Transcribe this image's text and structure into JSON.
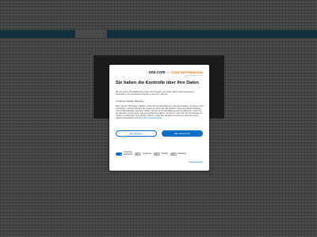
{
  "dialog": {
    "logo": {
      "brand": "one.com",
      "ampersand": "&",
      "partner": "CODE INFORMATION",
      "tagline": "code information consent"
    },
    "title": "Sie haben die Kontrolle über Ihre Daten",
    "intro": "Wir und unsere Geschäftspartner nutzen Technologien wie Cookies dazu, personenbezogene Informationen für verschiedene Zwecke zu sammeln, darunter:",
    "purposes": "Funktional, Statistik, Marketing",
    "body": "Wenn Sie auf \"Akzeptieren\" klicken, erteilen Sie Ihre Einwilligung für alle diese Zwecke. Sie können auch entscheiden, welchen Zwecken Sie zustimmen, indem Sie das Kästchen neben dem Zweck anklicken und auf \"Einstellungen speichern\" klicken. Sie können Ihre Einwilligung jederzeit widerrufen, indem Sie auf das kleine Symbol unten links auf der Webseite klicken. Sie können mehr über die Verwendung von Cookies und ähnlichen Technologien erfahren, sowie über die Datenverarbeitung, lesen Sie unsere Datenschutzrichtlinien und",
    "body_link": "Mehr über Cookie-Richtlinie",
    "reject_label": "Alle ablehnen",
    "accept_label": "Alle akzeptieren",
    "toggles": [
      {
        "label_line1": "Unbedingt",
        "label_line2": "erforderlich",
        "on": true
      },
      {
        "label_line1": "Funktional",
        "label_line2": "",
        "on": false
      },
      {
        "label_line1": "Statistik",
        "label_line2": "",
        "on": false
      },
      {
        "label_line1": "Marketing",
        "label_line2": "",
        "on": false
      }
    ],
    "details_link": "Details anzeigen"
  },
  "colors": {
    "accent": "#0a6ec8",
    "partner": "#e8730c",
    "topbar": "#0f2e3a",
    "overlay": "#4a4a4a"
  }
}
